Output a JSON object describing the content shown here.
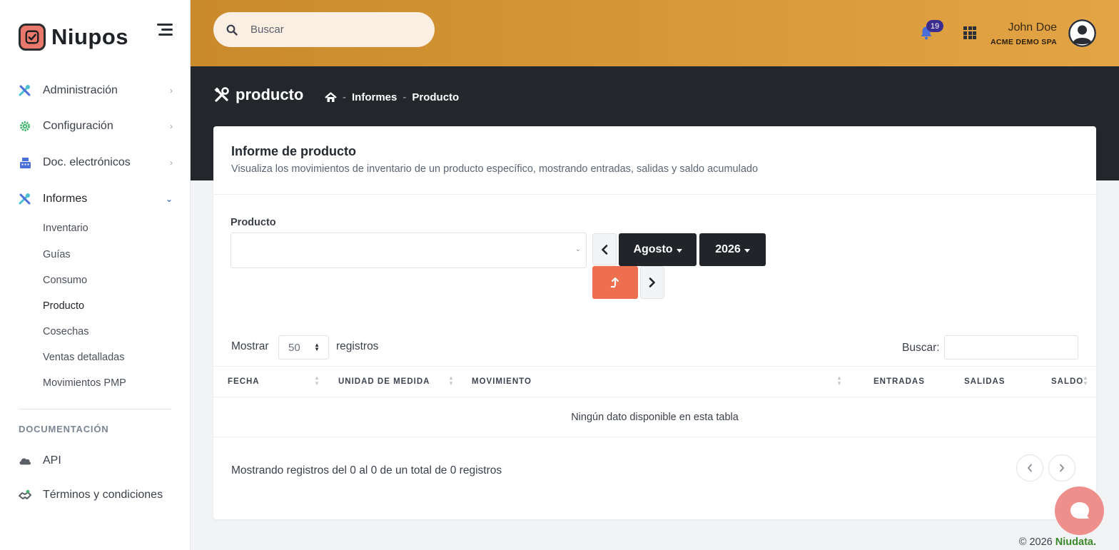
{
  "brand": {
    "name": "Niupos"
  },
  "sidebar": {
    "items": [
      {
        "label": "Administración",
        "icon": "tools-icon"
      },
      {
        "label": "Configuración",
        "icon": "gear-icon"
      },
      {
        "label": "Doc. electrónicos",
        "icon": "register-icon"
      },
      {
        "label": "Informes",
        "icon": "tools-icon"
      }
    ],
    "subitems": [
      "Inventario",
      "Guías",
      "Consumo",
      "Producto",
      "Cosechas",
      "Ventas detalladas",
      "Movimientos PMP"
    ],
    "section_title": "DOCUMENTACIÓN",
    "doc_items": [
      {
        "label": "API",
        "icon": "cloud-icon"
      },
      {
        "label": "Términos y condiciones",
        "icon": "handshake-icon"
      }
    ]
  },
  "header": {
    "search_placeholder": "Buscar",
    "notifications_count": "19",
    "user_name": "John Doe",
    "user_company": "ACME DEMO SPA"
  },
  "page": {
    "title": "producto",
    "breadcrumb": [
      "Informes",
      "Producto"
    ],
    "breadcrumb_sep": "-"
  },
  "card": {
    "title": "Informe de producto",
    "subtitle": "Visualiza los movimientos de inventario de un producto específico, mostrando entradas, salidas y saldo acumulado",
    "product_label": "Producto",
    "product_value": "",
    "month": "Agosto",
    "year": "2026"
  },
  "table": {
    "length_prefix": "Mostrar",
    "length_value": "50",
    "length_suffix": "registros",
    "filter_label": "Buscar:",
    "columns": [
      "FECHA",
      "UNIDAD DE MEDIDA",
      "MOVIMIENTO",
      "ENTRADAS",
      "SALIDAS",
      "SALDO"
    ],
    "empty_message": "Ningún dato disponible en esta tabla",
    "info": "Mostrando registros del 0 al 0 de un total de 0 registros"
  },
  "footer": {
    "copyright": "© 2026",
    "link": "Niudata."
  },
  "colors": {
    "accent_orange": "#ee6f4f",
    "header_gold": "#e2a444",
    "dark_band": "#23262b",
    "icon_blue": "#4a6fd8",
    "icon_teal": "#4cc0cf"
  }
}
